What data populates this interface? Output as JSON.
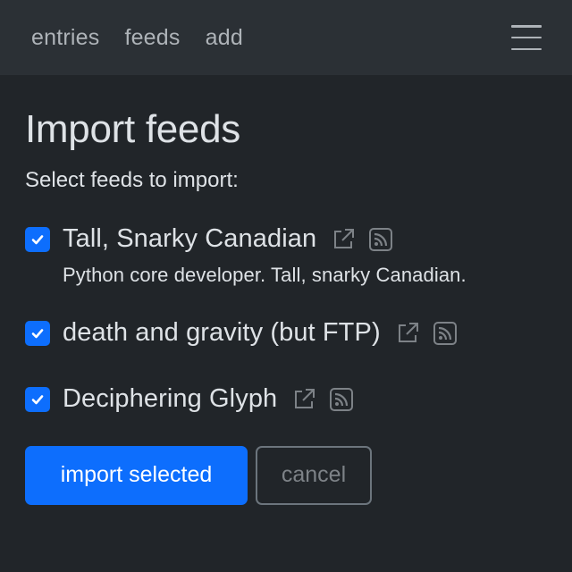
{
  "nav": {
    "links": [
      "entries",
      "feeds",
      "add"
    ],
    "menu_icon": "hamburger-icon"
  },
  "page": {
    "title": "Import feeds",
    "intro": "Select feeds to import:"
  },
  "feeds": [
    {
      "title": "Tall, Snarky Canadian",
      "description": "Python core developer. Tall, snarky Canadian.",
      "checked": true,
      "link_icon": "external-link-icon",
      "feed_icon": "rss-icon"
    },
    {
      "title": "death and gravity (but FTP)",
      "description": "",
      "checked": true,
      "link_icon": "external-link-icon",
      "feed_icon": "rss-icon"
    },
    {
      "title": "Deciphering Glyph",
      "description": "",
      "checked": true,
      "link_icon": "external-link-icon",
      "feed_icon": "rss-icon"
    }
  ],
  "actions": {
    "import_label": "import selected",
    "cancel_label": "cancel"
  },
  "colors": {
    "background": "#212529",
    "navbar": "#2b3035",
    "accent": "#0d6efd",
    "text": "#dee2e6",
    "muted": "#6c757d"
  }
}
